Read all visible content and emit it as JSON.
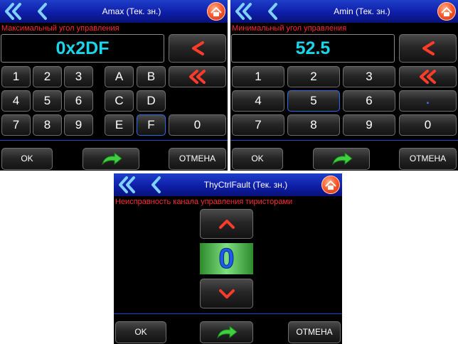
{
  "panel1": {
    "title": "Amax (Тек. зн.)",
    "subtitle": "Максимальный угол управления",
    "value": "0x2DF",
    "keys": [
      "1",
      "2",
      "3",
      "A",
      "B",
      "4",
      "5",
      "6",
      "C",
      "D",
      "7",
      "8",
      "9",
      "E",
      "F",
      "0"
    ],
    "ok": "OK",
    "cancel": "ОТМЕНА"
  },
  "panel2": {
    "title": "Amin (Тек. зн.)",
    "subtitle": "Минимальный угол управления",
    "value": "52.5",
    "keys": [
      "1",
      "2",
      "3",
      "4",
      "5",
      "6",
      ".",
      "7",
      "8",
      "9",
      "0"
    ],
    "ok": "OK",
    "cancel": "ОТМЕНА"
  },
  "panel3": {
    "title": "ThyCtrlFault (Тек. зн.)",
    "subtitle": "Неисправность канала управления тиристорами",
    "value": "0",
    "ok": "OK",
    "cancel": "ОТМЕНА"
  },
  "icons": {
    "back_double": "double-chevron-left-icon",
    "back": "chevron-left-icon",
    "home": "home-icon",
    "backspace": "arrow-left-red-icon",
    "clear": "double-arrow-left-red-icon",
    "apply": "green-arrow-icon",
    "up": "arrow-up-red-icon",
    "down": "arrow-down-red-icon"
  },
  "colors": {
    "titlebar": "#0f1ea8",
    "subtitle": "#ff2a2a",
    "display_text": "#19d6ea",
    "selected_border": "#2f6ae8",
    "digit_bg": "#4fb84f",
    "digit_text": "#1e5ce8"
  }
}
